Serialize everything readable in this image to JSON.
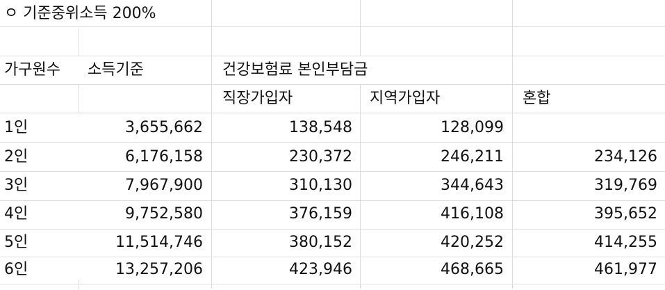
{
  "title": "ㅇ 기준중위소득 200%",
  "header": {
    "col_households": "가구원수",
    "col_income": "소득기준",
    "col_premium": "건강보험료 본인부담금",
    "sub_employee": "직장가입자",
    "sub_regional": "지역가입자",
    "sub_mixed": "혼합"
  },
  "rows": [
    {
      "h": "1인",
      "income": "3,655,662",
      "employee": "138,548",
      "regional": "128,099",
      "mixed": ""
    },
    {
      "h": "2인",
      "income": "6,176,158",
      "employee": "230,372",
      "regional": "246,211",
      "mixed": "234,126"
    },
    {
      "h": "3인",
      "income": "7,967,900",
      "employee": "310,130",
      "regional": "344,643",
      "mixed": "319,769"
    },
    {
      "h": "4인",
      "income": "9,752,580",
      "employee": "376,159",
      "regional": "416,108",
      "mixed": "395,652"
    },
    {
      "h": "5인",
      "income": "11,514,746",
      "employee": "380,152",
      "regional": "420,252",
      "mixed": "414,255"
    },
    {
      "h": "6인",
      "income": "13,257,206",
      "employee": "423,946",
      "regional": "468,665",
      "mixed": "461,977"
    }
  ]
}
